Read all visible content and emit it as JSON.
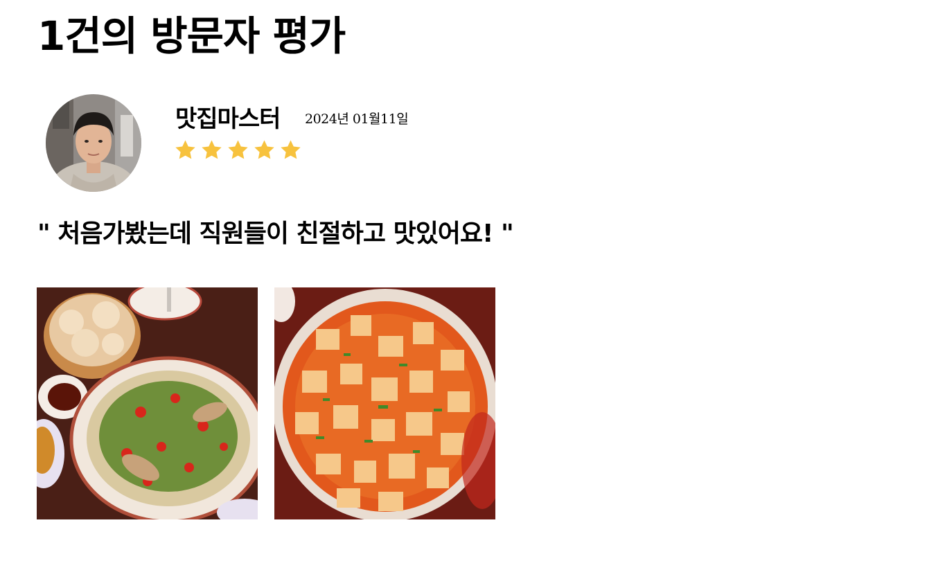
{
  "review_section": {
    "title": "1건의 방문자 평가"
  },
  "review": {
    "reviewer_name": "맛집마스터",
    "date": "2024년 01월11일",
    "rating": 5,
    "rating_max": 5,
    "star_color": "#F7C23E",
    "text": "\" 처음가봤는데 직원들이 친절하고 맛있어요! \"",
    "photos": [
      {
        "subject": "dumplings-and-chili-fish-dish"
      },
      {
        "subject": "mapo-tofu"
      }
    ]
  }
}
